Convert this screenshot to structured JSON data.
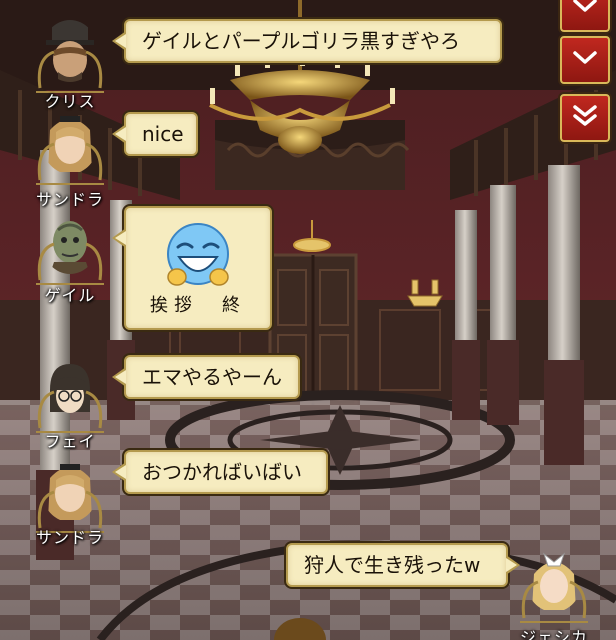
{
  "controls": {
    "buttons": [
      {
        "icon": "chevron-down-icon"
      },
      {
        "icon": "chevron-down-icon"
      },
      {
        "icon": "double-chevron-down-icon"
      }
    ]
  },
  "chat": {
    "messages": [
      {
        "speaker": "クリス",
        "text": "ゲイルとパープルゴリラ黒すぎやろ",
        "side": "left"
      },
      {
        "speaker": "サンドラ",
        "text": "nice",
        "side": "left"
      },
      {
        "speaker": "ゲイル",
        "sticker": "laughing-emoji-sticker",
        "text": "挨拶　終",
        "side": "left"
      },
      {
        "speaker": "フェイ",
        "text": "エマやるやーん",
        "side": "left"
      },
      {
        "speaker": "サンドラ",
        "text": "おつかればいばい",
        "side": "left"
      },
      {
        "speaker": "ジェシカ",
        "text": "狩人で生き残ったw",
        "side": "right"
      }
    ]
  },
  "colors": {
    "bubble_fill": "#f6ecc0",
    "bubble_border": "#b49a4e",
    "button_red": "#c0281f",
    "wall_red": "#6e2a2e"
  }
}
